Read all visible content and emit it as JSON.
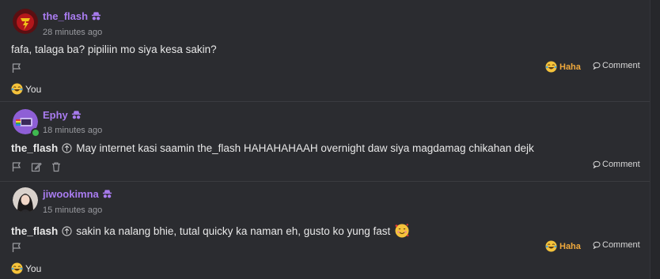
{
  "posts": [
    {
      "author": "the_flash",
      "time": "28 minutes ago",
      "message": "fafa, talaga ba? pipiliin mo siya kesa sakin?",
      "reaction_label": "Haha",
      "comment_label": "Comment",
      "reaction_summary": "You",
      "avatar_color": "#7a1a1a"
    },
    {
      "author": "Ephy",
      "time": "18 minutes ago",
      "quote_author": "the_flash",
      "message": "May internet kasi saamin the_flash HAHAHAHAAH overnight daw siya magdamag chikahan dejk",
      "comment_label": "Comment",
      "avatar_color": "#8e5fd6"
    },
    {
      "author": "jiwookimna",
      "time": "15 minutes ago",
      "quote_author": "the_flash",
      "message": "sakin ka nalang bhie, tutal quicky ka naman eh, gusto ko yung fast",
      "reaction_label": "Haha",
      "comment_label": "Comment",
      "reaction_summary": "You",
      "avatar_color": "#d9d2cc"
    }
  ],
  "colors": {
    "background": "#2b2c30",
    "author": "#a97cf0",
    "haha": "#f0a93c",
    "muted": "#9a9ba0"
  }
}
